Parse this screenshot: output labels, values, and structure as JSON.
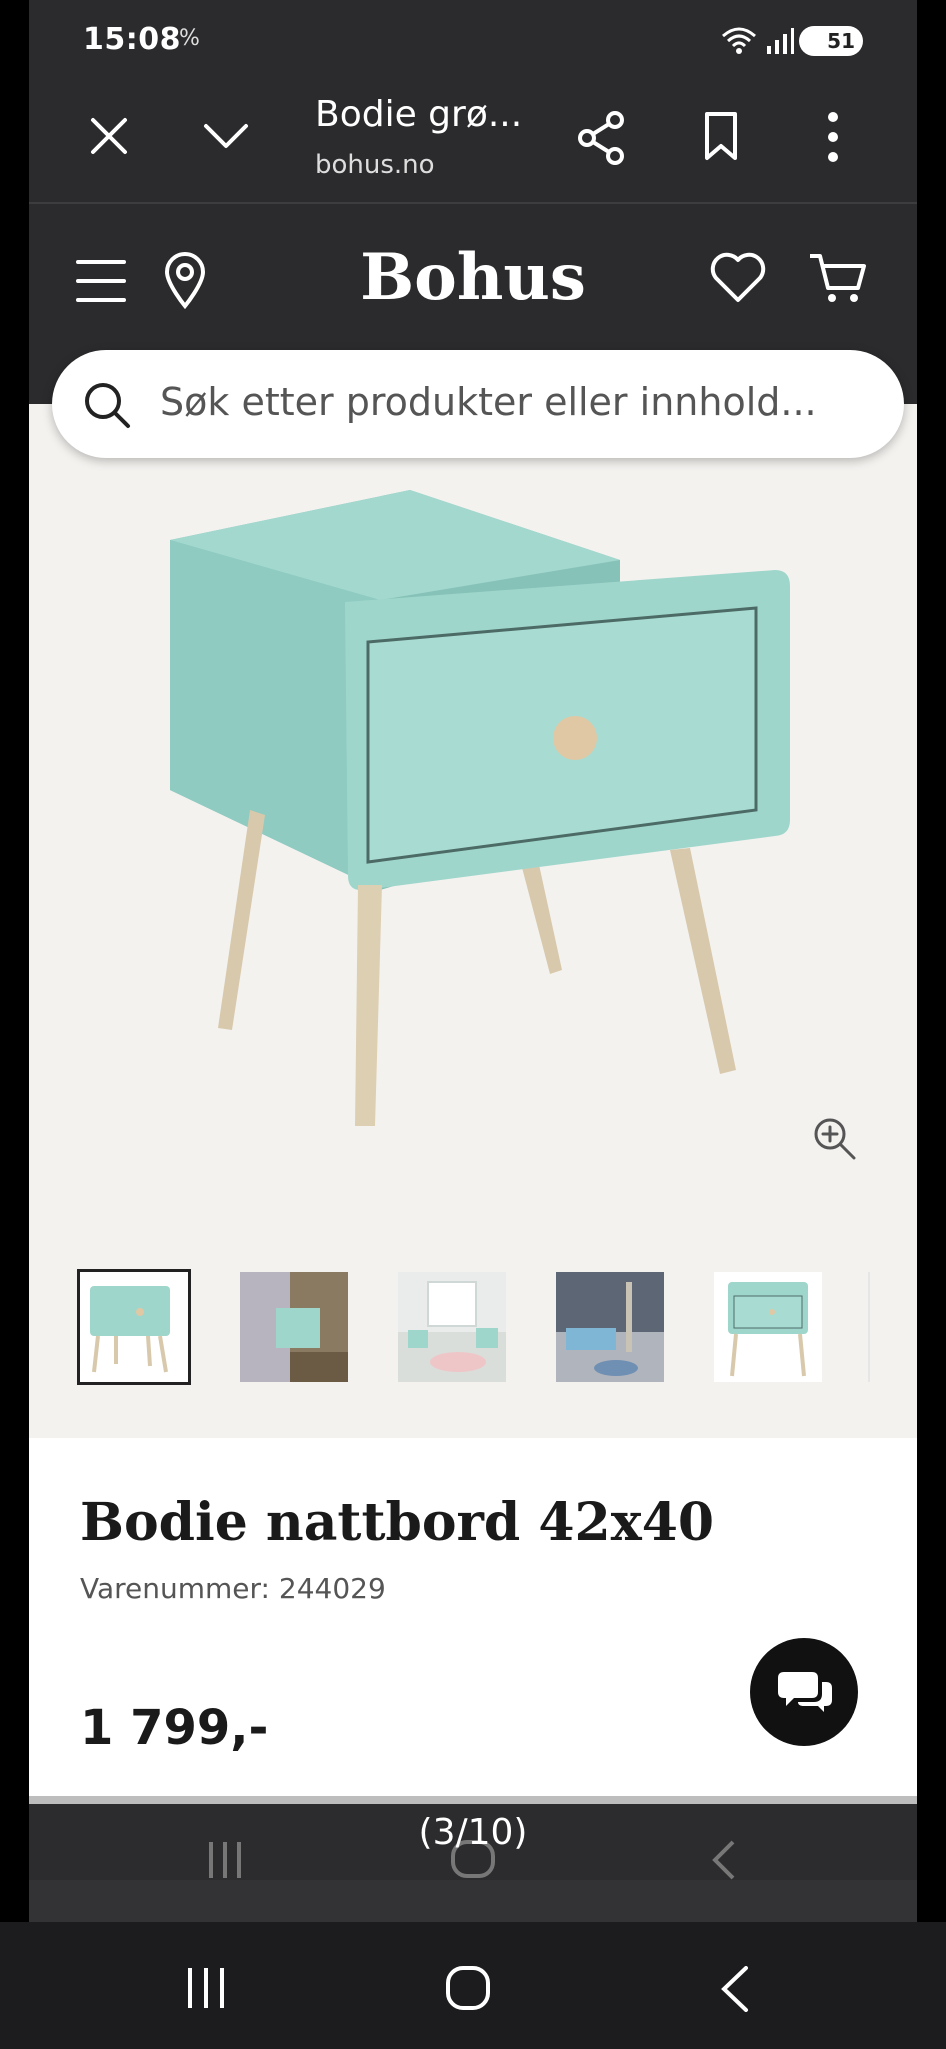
{
  "status": {
    "time": "15:08",
    "extra": "%",
    "battery": "51"
  },
  "browser": {
    "tab_title": "Bodie grø...",
    "url": "bohus.no"
  },
  "site": {
    "logo": "Bohus",
    "search_placeholder": "Søk etter produkter eller innhold..."
  },
  "product": {
    "name": "Bodie nattbord 42x40",
    "sku_label": "Varenummer:",
    "sku": "244029",
    "price": "1 799,-",
    "color": "#9fd6cc"
  },
  "gallery": {
    "counter": "(3/10)",
    "thumb_count": 5,
    "selected": 0
  },
  "colors": {
    "toolbar": "#2b2b2d",
    "page_bg": "#f4f2ef",
    "accent": "#111111"
  }
}
